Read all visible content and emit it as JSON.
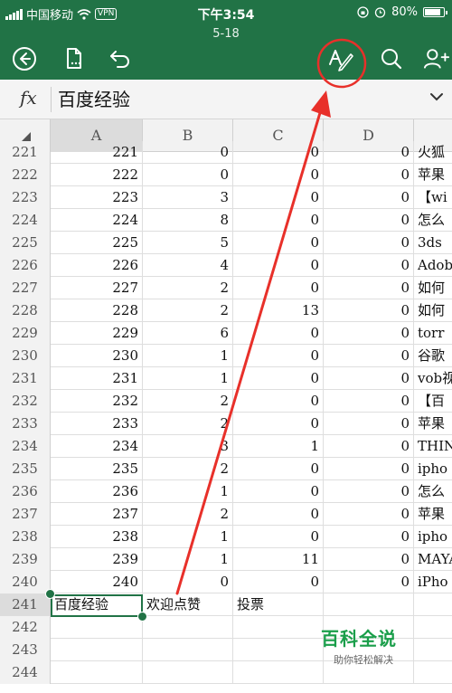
{
  "status_bar": {
    "carrier": "中国移动",
    "vpn": "VPN",
    "time": "下午3:54",
    "battery": "80%"
  },
  "document": {
    "title": "5-18"
  },
  "toolbar": {
    "back_icon": "back-circle-icon",
    "file_icon": "file-menu-icon",
    "undo_icon": "undo-icon",
    "edit_icon": "text-edit-icon",
    "search_icon": "search-icon",
    "share_icon": "add-person-icon"
  },
  "formula_bar": {
    "fx_label": "fx",
    "content": "百度经验"
  },
  "columns": [
    "A",
    "B",
    "C",
    "D"
  ],
  "rows": [
    {
      "num": "221",
      "a": "221",
      "b": "0",
      "c": "0",
      "d": "0",
      "e": "火狐"
    },
    {
      "num": "222",
      "a": "222",
      "b": "0",
      "c": "0",
      "d": "0",
      "e": "苹果"
    },
    {
      "num": "223",
      "a": "223",
      "b": "3",
      "c": "0",
      "d": "0",
      "e": "【wi"
    },
    {
      "num": "224",
      "a": "224",
      "b": "8",
      "c": "0",
      "d": "0",
      "e": "怎么"
    },
    {
      "num": "225",
      "a": "225",
      "b": "5",
      "c": "0",
      "d": "0",
      "e": "3ds"
    },
    {
      "num": "226",
      "a": "226",
      "b": "4",
      "c": "0",
      "d": "0",
      "e": "Adob"
    },
    {
      "num": "227",
      "a": "227",
      "b": "2",
      "c": "0",
      "d": "0",
      "e": "如何"
    },
    {
      "num": "228",
      "a": "228",
      "b": "2",
      "c": "13",
      "d": "0",
      "e": "如何"
    },
    {
      "num": "229",
      "a": "229",
      "b": "6",
      "c": "0",
      "d": "0",
      "e": "torr"
    },
    {
      "num": "230",
      "a": "230",
      "b": "1",
      "c": "0",
      "d": "0",
      "e": "谷歌"
    },
    {
      "num": "231",
      "a": "231",
      "b": "1",
      "c": "0",
      "d": "0",
      "e": "vob视"
    },
    {
      "num": "232",
      "a": "232",
      "b": "2",
      "c": "0",
      "d": "0",
      "e": "【百"
    },
    {
      "num": "233",
      "a": "233",
      "b": "2",
      "c": "0",
      "d": "0",
      "e": "苹果"
    },
    {
      "num": "234",
      "a": "234",
      "b": "3",
      "c": "1",
      "d": "0",
      "e": "THIN"
    },
    {
      "num": "235",
      "a": "235",
      "b": "2",
      "c": "0",
      "d": "0",
      "e": "ipho"
    },
    {
      "num": "236",
      "a": "236",
      "b": "1",
      "c": "0",
      "d": "0",
      "e": "怎么"
    },
    {
      "num": "237",
      "a": "237",
      "b": "2",
      "c": "0",
      "d": "0",
      "e": "苹果"
    },
    {
      "num": "238",
      "a": "238",
      "b": "1",
      "c": "0",
      "d": "0",
      "e": "ipho"
    },
    {
      "num": "239",
      "a": "239",
      "b": "1",
      "c": "11",
      "d": "0",
      "e": "MAYA"
    },
    {
      "num": "240",
      "a": "240",
      "b": "0",
      "c": "0",
      "d": "0",
      "e": "iPho"
    },
    {
      "num": "241",
      "a": "百度经验",
      "b": "欢迎点赞",
      "c": "投票",
      "d": "",
      "e": ""
    },
    {
      "num": "242",
      "a": "",
      "b": "",
      "c": "",
      "d": "",
      "e": ""
    },
    {
      "num": "243",
      "a": "",
      "b": "",
      "c": "",
      "d": "",
      "e": ""
    },
    {
      "num": "244",
      "a": "",
      "b": "",
      "c": "",
      "d": "",
      "e": ""
    }
  ],
  "watermark": {
    "brand": "百科全说",
    "tagline": "助你轻松解决"
  },
  "colors": {
    "accent": "#217346",
    "annotation": "#e8302a"
  }
}
